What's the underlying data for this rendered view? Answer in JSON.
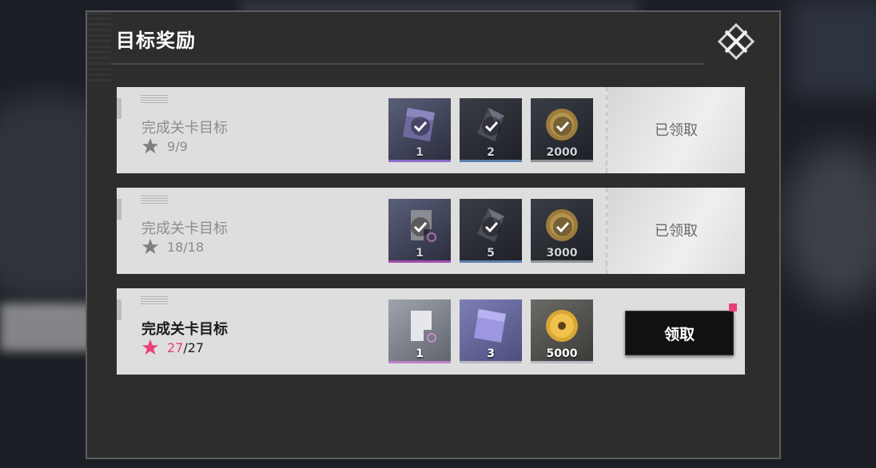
{
  "panel": {
    "title": "目标奖励"
  },
  "rewards": [
    {
      "title": "完成关卡目标",
      "progress_current": "9",
      "progress_total": "/9",
      "status": "claimed",
      "status_label": "已领取",
      "items": [
        {
          "name": "purple-card-icon",
          "qty": "1"
        },
        {
          "name": "dark-crystal-icon",
          "qty": "2"
        },
        {
          "name": "gold-coin-icon",
          "qty": "2000"
        }
      ]
    },
    {
      "title": "完成关卡目标",
      "progress_current": "18",
      "progress_total": "/18",
      "status": "claimed",
      "status_label": "已领取",
      "items": [
        {
          "name": "silver-tag-icon",
          "qty": "1"
        },
        {
          "name": "dark-crystal-icon",
          "qty": "5"
        },
        {
          "name": "gold-coin-icon",
          "qty": "3000"
        }
      ]
    },
    {
      "title": "完成关卡目标",
      "progress_current": "27",
      "progress_total": "/27",
      "status": "claimable",
      "status_label": "领取",
      "items": [
        {
          "name": "silver-tag-icon",
          "qty": "1"
        },
        {
          "name": "purple-card-icon",
          "qty": "3"
        },
        {
          "name": "gold-coin-icon",
          "qty": "5000"
        }
      ]
    }
  ],
  "colors": {
    "accent_pink": "#e8407d",
    "panel_bg": "#2d2d2e",
    "row_bg": "#dedede"
  }
}
